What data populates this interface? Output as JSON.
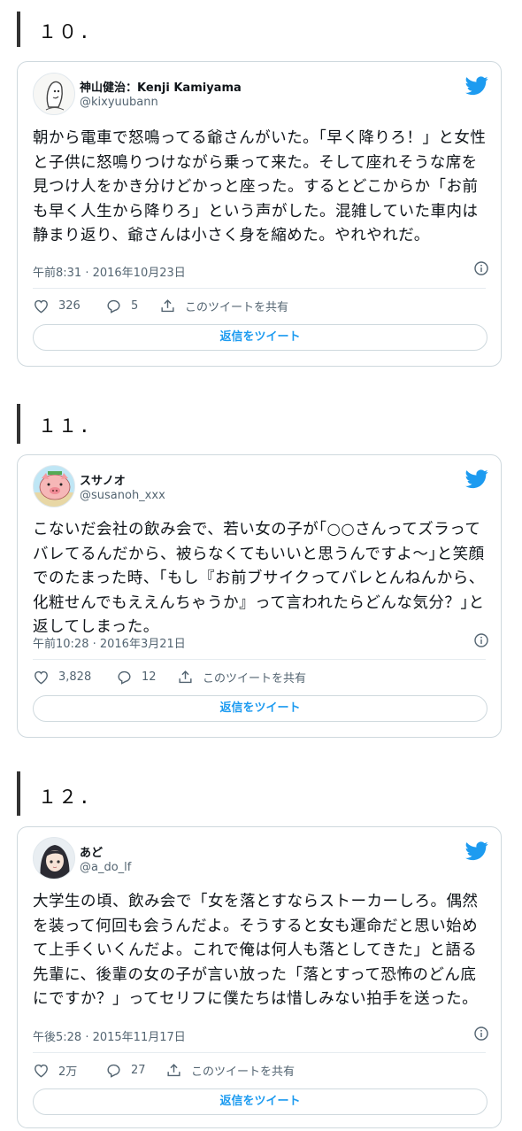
{
  "tweets": [
    {
      "number": "１０.",
      "name": "神山健治：Kenji Kamiyama",
      "handle": "@kixyuubann",
      "text": "朝から電車で怒鳴ってる爺さんがいた。「早く降りろ！」と女性と子供に怒鳴りつけながら乗って来た。そして座れそうな席を見つけ人をかき分けどかっと座った。するとどこからか「お前も早く人生から降りろ」という声がした。混雑していた車内は静まり返り、爺さんは小さく身を縮めた。やれやれだ。",
      "timestamp": "午前8:31 · 2016年10月23日",
      "likes": "326",
      "replies": "5",
      "share_label": "このツイートを共有",
      "reply_button": "返信をツイート"
    },
    {
      "number": "１１.",
      "name": "スサノオ",
      "handle": "@susanoh_xxx",
      "text": "こないだ会社の飲み会で、若い女の子が｢○○さんってズラってバレてるんだから、被らなくてもいいと思うんですよ～｣と笑顔でのたまった時、｢もし『お前ブサイクってバレとんねんから、化粧せんでもええんちゃうか』って言われたらどんな気分？｣と返してしまった。",
      "timestamp": "午前10:28 · 2016年3月21日",
      "likes": "3,828",
      "replies": "12",
      "share_label": "このツイートを共有",
      "reply_button": "返信をツイート"
    },
    {
      "number": "１２.",
      "name": "あど",
      "handle": "@a_do_lf",
      "text": "大学生の頃、飲み会で「女を落とすならストーカーしろ。偶然を装って何回も会うんだよ。そうすると女も運命だと思い始めて上手くいくんだよ。これで俺は何人も落としてきた」と語る先輩に、後輩の女の子が言い放った「落とすって恐怖のどん底にですか？」ってセリフに僕たちは惜しみない拍手を送った。",
      "timestamp": "午後5:28 · 2015年11月17日",
      "likes": "2万",
      "replies": "27",
      "share_label": "このツイートを共有",
      "reply_button": "返信をツイート"
    }
  ],
  "colors": {
    "accent": "#1d9bf0",
    "muted": "#536471",
    "border": "#cfd9de",
    "heading_bar": "#333333"
  },
  "icons": [
    "twitter-bird-icon",
    "info-icon",
    "heart-icon",
    "reply-icon",
    "share-icon"
  ]
}
